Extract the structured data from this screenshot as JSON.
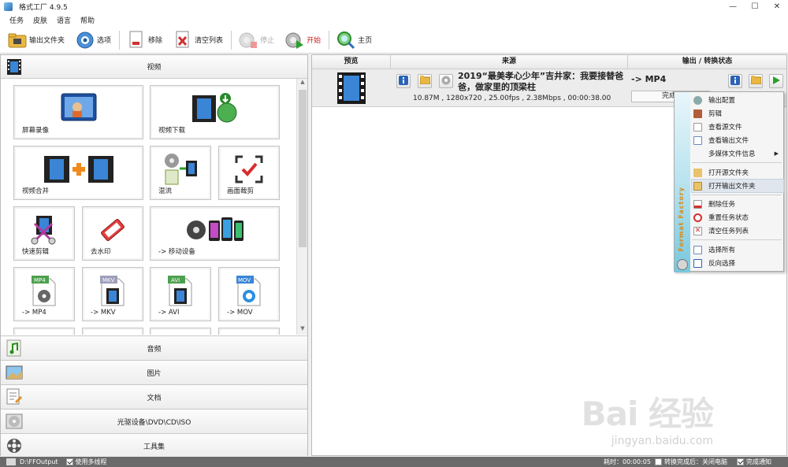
{
  "window": {
    "title": "格式工厂 4.9.5",
    "minimize": "—",
    "maximize": "☐",
    "close": "✕"
  },
  "menu": [
    "任务",
    "皮肤",
    "语言",
    "帮助"
  ],
  "toolbar": {
    "output_folder": "输出文件夹",
    "options": "选项",
    "remove": "移除",
    "clear_list": "清空列表",
    "stop": "停止",
    "start": "开始",
    "home": "主页"
  },
  "left": {
    "video_header": "视频",
    "tiles": [
      {
        "label": "屏幕录像",
        "icon": "screen-record-icon"
      },
      {
        "label": "视频下载",
        "icon": "video-download-icon"
      },
      {
        "label": "视频合并",
        "icon": "video-merge-icon"
      },
      {
        "label": "混流",
        "icon": "mux-icon"
      },
      {
        "label": "画面裁剪",
        "icon": "crop-icon"
      },
      {
        "label": "快速剪辑",
        "icon": "quick-clip-icon"
      },
      {
        "label": "去水印",
        "icon": "remove-watermark-icon"
      },
      {
        "label": "-> 移动设备",
        "icon": "mobile-device-icon"
      },
      {
        "label": "-> MP4",
        "icon": "mp4-icon",
        "tag": "MP4"
      },
      {
        "label": "-> MKV",
        "icon": "mkv-icon",
        "tag": "MKV"
      },
      {
        "label": "-> AVI",
        "icon": "avi-icon",
        "tag": "AVI"
      },
      {
        "label": "-> MOV",
        "icon": "mov-icon",
        "tag": "MOV"
      }
    ],
    "categories": [
      "音频",
      "图片",
      "文档",
      "光驱设备\\DVD\\CD\\ISO",
      "工具集"
    ]
  },
  "table": {
    "headers": [
      "预览",
      "来源",
      "输出 / 转换状态"
    ],
    "task": {
      "filename": "2019“最美孝心少年”吉井家：我要接替爸爸，做家里的顶梁柱",
      "info": "10.87M , 1280x720 , 25.00fps , 2.38Mbps , 00:00:38.00",
      "format": "-> MP4",
      "status": "完成",
      "progress": 1.0
    }
  },
  "context_menu": {
    "brand": "Format Factory",
    "items": [
      {
        "label": "输出配置",
        "icon": "settings-icon"
      },
      {
        "label": "剪辑",
        "icon": "clip-icon"
      },
      {
        "label": "查看源文件",
        "icon": "view-source-icon"
      },
      {
        "label": "查看输出文件",
        "icon": "view-output-icon"
      },
      {
        "label": "多媒体文件信息",
        "icon": "media-info-icon",
        "submenu": "▶"
      },
      {
        "label": "打开源文件夹",
        "icon": "folder-icon"
      },
      {
        "label": "打开输出文件夹",
        "icon": "open-output-folder-icon",
        "highlighted": true
      },
      {
        "label": "删除任务",
        "icon": "delete-icon"
      },
      {
        "label": "重置任务状态",
        "icon": "reset-icon"
      },
      {
        "label": "清空任务列表",
        "icon": "clear-icon"
      },
      {
        "label": "选择所有",
        "icon": "select-all-icon"
      },
      {
        "label": "反向选择",
        "icon": "invert-icon"
      }
    ]
  },
  "status": {
    "output_path": "D:\\FFOutput",
    "multithread": "使用多线程",
    "elapsed": "耗时：00:00:05",
    "after": "转换完成后：关闭电脑",
    "notify": "完成通知"
  },
  "watermark": {
    "main": "Bai 经验",
    "sub": "jingyan.baidu.com"
  },
  "colors": {
    "accent": "#2a6fb5",
    "start_red": "#d01c1c",
    "brand_orange": "#d88a1b"
  }
}
